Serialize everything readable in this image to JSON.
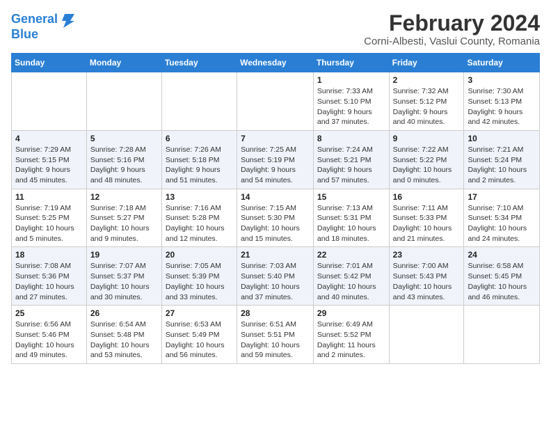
{
  "header": {
    "logo_line1": "General",
    "logo_line2": "Blue",
    "month": "February 2024",
    "location": "Corni-Albesti, Vaslui County, Romania"
  },
  "weekdays": [
    "Sunday",
    "Monday",
    "Tuesday",
    "Wednesday",
    "Thursday",
    "Friday",
    "Saturday"
  ],
  "weeks": [
    [
      {
        "num": "",
        "info": ""
      },
      {
        "num": "",
        "info": ""
      },
      {
        "num": "",
        "info": ""
      },
      {
        "num": "",
        "info": ""
      },
      {
        "num": "1",
        "info": "Sunrise: 7:33 AM\nSunset: 5:10 PM\nDaylight: 9 hours\nand 37 minutes."
      },
      {
        "num": "2",
        "info": "Sunrise: 7:32 AM\nSunset: 5:12 PM\nDaylight: 9 hours\nand 40 minutes."
      },
      {
        "num": "3",
        "info": "Sunrise: 7:30 AM\nSunset: 5:13 PM\nDaylight: 9 hours\nand 42 minutes."
      }
    ],
    [
      {
        "num": "4",
        "info": "Sunrise: 7:29 AM\nSunset: 5:15 PM\nDaylight: 9 hours\nand 45 minutes."
      },
      {
        "num": "5",
        "info": "Sunrise: 7:28 AM\nSunset: 5:16 PM\nDaylight: 9 hours\nand 48 minutes."
      },
      {
        "num": "6",
        "info": "Sunrise: 7:26 AM\nSunset: 5:18 PM\nDaylight: 9 hours\nand 51 minutes."
      },
      {
        "num": "7",
        "info": "Sunrise: 7:25 AM\nSunset: 5:19 PM\nDaylight: 9 hours\nand 54 minutes."
      },
      {
        "num": "8",
        "info": "Sunrise: 7:24 AM\nSunset: 5:21 PM\nDaylight: 9 hours\nand 57 minutes."
      },
      {
        "num": "9",
        "info": "Sunrise: 7:22 AM\nSunset: 5:22 PM\nDaylight: 10 hours\nand 0 minutes."
      },
      {
        "num": "10",
        "info": "Sunrise: 7:21 AM\nSunset: 5:24 PM\nDaylight: 10 hours\nand 2 minutes."
      }
    ],
    [
      {
        "num": "11",
        "info": "Sunrise: 7:19 AM\nSunset: 5:25 PM\nDaylight: 10 hours\nand 5 minutes."
      },
      {
        "num": "12",
        "info": "Sunrise: 7:18 AM\nSunset: 5:27 PM\nDaylight: 10 hours\nand 9 minutes."
      },
      {
        "num": "13",
        "info": "Sunrise: 7:16 AM\nSunset: 5:28 PM\nDaylight: 10 hours\nand 12 minutes."
      },
      {
        "num": "14",
        "info": "Sunrise: 7:15 AM\nSunset: 5:30 PM\nDaylight: 10 hours\nand 15 minutes."
      },
      {
        "num": "15",
        "info": "Sunrise: 7:13 AM\nSunset: 5:31 PM\nDaylight: 10 hours\nand 18 minutes."
      },
      {
        "num": "16",
        "info": "Sunrise: 7:11 AM\nSunset: 5:33 PM\nDaylight: 10 hours\nand 21 minutes."
      },
      {
        "num": "17",
        "info": "Sunrise: 7:10 AM\nSunset: 5:34 PM\nDaylight: 10 hours\nand 24 minutes."
      }
    ],
    [
      {
        "num": "18",
        "info": "Sunrise: 7:08 AM\nSunset: 5:36 PM\nDaylight: 10 hours\nand 27 minutes."
      },
      {
        "num": "19",
        "info": "Sunrise: 7:07 AM\nSunset: 5:37 PM\nDaylight: 10 hours\nand 30 minutes."
      },
      {
        "num": "20",
        "info": "Sunrise: 7:05 AM\nSunset: 5:39 PM\nDaylight: 10 hours\nand 33 minutes."
      },
      {
        "num": "21",
        "info": "Sunrise: 7:03 AM\nSunset: 5:40 PM\nDaylight: 10 hours\nand 37 minutes."
      },
      {
        "num": "22",
        "info": "Sunrise: 7:01 AM\nSunset: 5:42 PM\nDaylight: 10 hours\nand 40 minutes."
      },
      {
        "num": "23",
        "info": "Sunrise: 7:00 AM\nSunset: 5:43 PM\nDaylight: 10 hours\nand 43 minutes."
      },
      {
        "num": "24",
        "info": "Sunrise: 6:58 AM\nSunset: 5:45 PM\nDaylight: 10 hours\nand 46 minutes."
      }
    ],
    [
      {
        "num": "25",
        "info": "Sunrise: 6:56 AM\nSunset: 5:46 PM\nDaylight: 10 hours\nand 49 minutes."
      },
      {
        "num": "26",
        "info": "Sunrise: 6:54 AM\nSunset: 5:48 PM\nDaylight: 10 hours\nand 53 minutes."
      },
      {
        "num": "27",
        "info": "Sunrise: 6:53 AM\nSunset: 5:49 PM\nDaylight: 10 hours\nand 56 minutes."
      },
      {
        "num": "28",
        "info": "Sunrise: 6:51 AM\nSunset: 5:51 PM\nDaylight: 10 hours\nand 59 minutes."
      },
      {
        "num": "29",
        "info": "Sunrise: 6:49 AM\nSunset: 5:52 PM\nDaylight: 11 hours\nand 2 minutes."
      },
      {
        "num": "",
        "info": ""
      },
      {
        "num": "",
        "info": ""
      }
    ]
  ]
}
